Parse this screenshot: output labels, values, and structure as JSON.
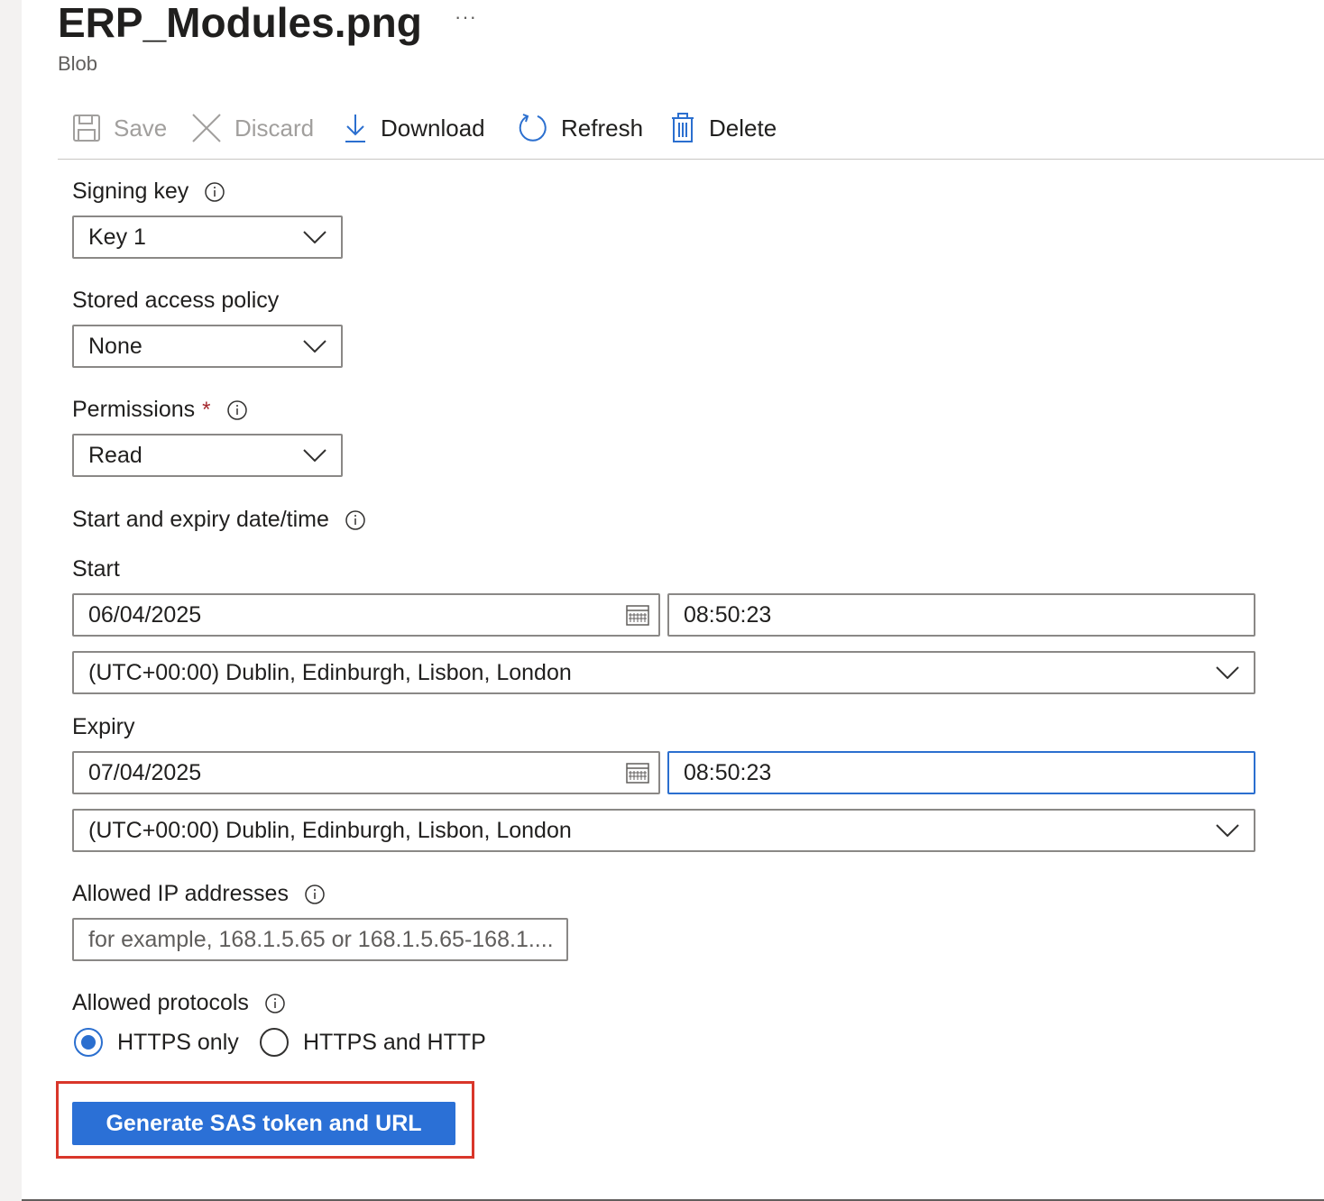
{
  "header": {
    "title": "ERP_Modules.png",
    "more": "···",
    "subtitle": "Blob"
  },
  "toolbar": {
    "save": "Save",
    "discard": "Discard",
    "download": "Download",
    "refresh": "Refresh",
    "delete": "Delete"
  },
  "form": {
    "signing_key": {
      "label": "Signing key",
      "value": "Key 1"
    },
    "stored_policy": {
      "label": "Stored access policy",
      "value": "None"
    },
    "permissions": {
      "label": "Permissions",
      "required": "*",
      "value": "Read"
    },
    "datetime_heading": "Start and expiry date/time",
    "start": {
      "label": "Start",
      "date": "06/04/2025",
      "time": "08:50:23",
      "timezone": "(UTC+00:00) Dublin, Edinburgh, Lisbon, London"
    },
    "expiry": {
      "label": "Expiry",
      "date": "07/04/2025",
      "time": "08:50:23",
      "timezone": "(UTC+00:00) Dublin, Edinburgh, Lisbon, London"
    },
    "allowed_ip": {
      "label": "Allowed IP addresses",
      "placeholder": "for example, 168.1.5.65 or 168.1.5.65-168.1...."
    },
    "protocols": {
      "label": "Allowed protocols",
      "options": [
        "HTTPS only",
        "HTTPS and HTTP"
      ],
      "selected": "HTTPS only"
    },
    "generate_button": "Generate SAS token and URL"
  },
  "colors": {
    "accent": "#2b70d6",
    "highlight_border": "#d9362a",
    "required": "#a4262c"
  }
}
